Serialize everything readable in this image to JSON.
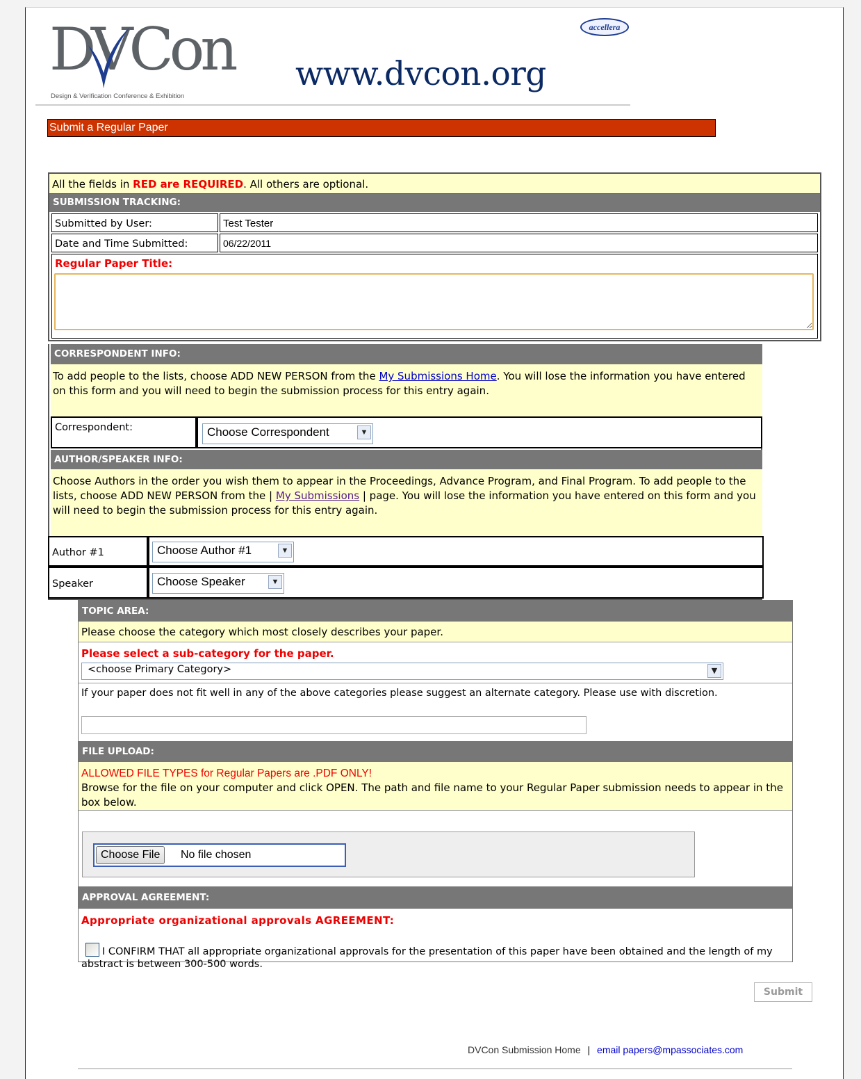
{
  "header": {
    "logo_text": "DVCon",
    "tagline": "Design & Verification Conference & Exhibition",
    "url": "www.dvcon.org",
    "partner_logo": "accellera"
  },
  "banner": "Submit a Regular Paper",
  "form": {
    "required_note_prefix": "All the fields in ",
    "required_note_red": "RED are REQUIRED",
    "required_note_suffix": ". All others are optional.",
    "tracking_header": "SUBMISSION TRACKING:",
    "submitted_by_label": "Submitted by User:",
    "submitted_by_value": "Test Tester",
    "date_label": "Date and Time Submitted:",
    "date_value": "06/22/2011",
    "title_label": "Regular Paper Title:",
    "title_value": "",
    "correspondent_header": "CORRESPONDENT INFO:",
    "correspondent_note_pre": "To add people to the lists, choose ADD NEW PERSON from the ",
    "correspondent_note_link": "My Submissions Home",
    "correspondent_note_post": ". You will lose the information you have entered on this form and you will need to begin the submission process for this entry again.",
    "correspondent_label": "Correspondent:",
    "correspondent_select": "Choose Correspondent",
    "author_header": "AUTHOR/SPEAKER INFO:",
    "author_note_pre": "Choose Authors in the order you wish them to appear in the Proceedings, Advance Program, and Final Program. To add people to the lists, choose ADD NEW PERSON from the | ",
    "author_note_link": "My Submissions",
    "author_note_post": " | page. You will lose the information you have entered on this form and you will need to begin the submission process for this entry again.",
    "author1_label": "Author #1",
    "author1_select": "Choose Author #1",
    "speaker_label": "Speaker",
    "speaker_select": "Choose Speaker",
    "topic_header": "TOPIC AREA:",
    "topic_note": "Please choose the category which most closely describes your paper.",
    "subcategory_label": "Please select a sub-category for the paper.",
    "category_select": "<choose Primary Category>",
    "alt_category_note": "If your paper does not fit well in any of the above categories please suggest an alternate category. Please use with discretion.",
    "alt_category_value": "",
    "upload_header": "FILE UPLOAD:",
    "upload_allowed": "ALLOWED FILE TYPES for Regular Papers are .PDF ONLY!",
    "upload_note": "Browse for the file on your computer and click OPEN. The path and file name to your Regular Paper submission needs to appear in the box below.",
    "choose_file_button": "Choose File",
    "no_file_text": "No file chosen",
    "approval_header": "APPROVAL AGREEMENT:",
    "approval_label": "Appropriate organizational approvals AGREEMENT:",
    "approval_confirm": "I CONFIRM THAT all appropriate organizational approvals for the presentation of this paper have been obtained and the length of my abstract is between 300-500 words.",
    "submit_button": "Submit"
  },
  "footer": {
    "home_link": "DVCon Submission Home",
    "separator": "|",
    "email_link": "email papers@mpassociates.com"
  }
}
